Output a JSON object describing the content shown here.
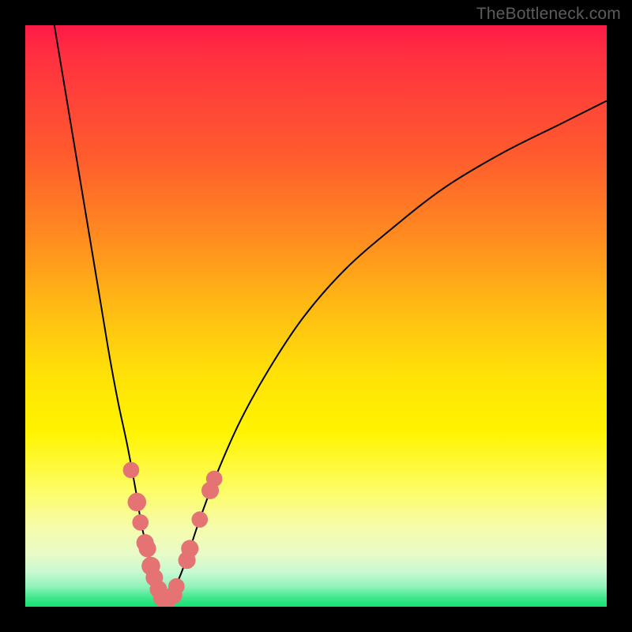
{
  "watermark": "TheBottleneck.com",
  "chart_data": {
    "type": "line",
    "title": "",
    "xlabel": "",
    "ylabel": "",
    "xlim": [
      0,
      100
    ],
    "ylim": [
      0,
      100
    ],
    "series": [
      {
        "name": "left-branch",
        "x": [
          5,
          7,
          9,
          11,
          13,
          14.5,
          16,
          17.5,
          19,
          20,
          21,
          22,
          23,
          24
        ],
        "y": [
          100,
          88,
          76,
          64,
          52,
          43,
          35,
          28,
          20,
          14,
          10,
          6,
          3,
          0.5
        ]
      },
      {
        "name": "right-branch",
        "x": [
          24,
          25,
          26.5,
          28,
          30,
          33,
          37,
          42,
          48,
          55,
          63,
          72,
          82,
          92,
          100
        ],
        "y": [
          0.5,
          2,
          5,
          9,
          15,
          23,
          32,
          41,
          50,
          58,
          65,
          72,
          78,
          83,
          87
        ]
      }
    ],
    "markers": {
      "name": "highlighted-points",
      "color": "#e57373",
      "points": [
        {
          "x": 18.2,
          "y": 23.5,
          "r": 1.4
        },
        {
          "x": 19.2,
          "y": 18.0,
          "r": 1.6
        },
        {
          "x": 19.8,
          "y": 14.5,
          "r": 1.4
        },
        {
          "x": 20.6,
          "y": 11.0,
          "r": 1.5
        },
        {
          "x": 21.0,
          "y": 10.0,
          "r": 1.5
        },
        {
          "x": 21.6,
          "y": 7.0,
          "r": 1.6
        },
        {
          "x": 22.2,
          "y": 5.0,
          "r": 1.5
        },
        {
          "x": 22.9,
          "y": 3.0,
          "r": 1.5
        },
        {
          "x": 23.5,
          "y": 1.5,
          "r": 1.5
        },
        {
          "x": 24.2,
          "y": 0.7,
          "r": 1.5
        },
        {
          "x": 25.5,
          "y": 2.0,
          "r": 1.5
        },
        {
          "x": 26.0,
          "y": 3.5,
          "r": 1.4
        },
        {
          "x": 27.8,
          "y": 8.0,
          "r": 1.5
        },
        {
          "x": 28.3,
          "y": 10.0,
          "r": 1.5
        },
        {
          "x": 30.0,
          "y": 15.0,
          "r": 1.4
        },
        {
          "x": 31.8,
          "y": 20.0,
          "r": 1.5
        },
        {
          "x": 32.5,
          "y": 22.0,
          "r": 1.4
        }
      ]
    },
    "gradient_stops": [
      {
        "pos": 0,
        "color": "#ff1a47"
      },
      {
        "pos": 0.6,
        "color": "#fff400"
      },
      {
        "pos": 1.0,
        "color": "#14e275"
      }
    ]
  }
}
